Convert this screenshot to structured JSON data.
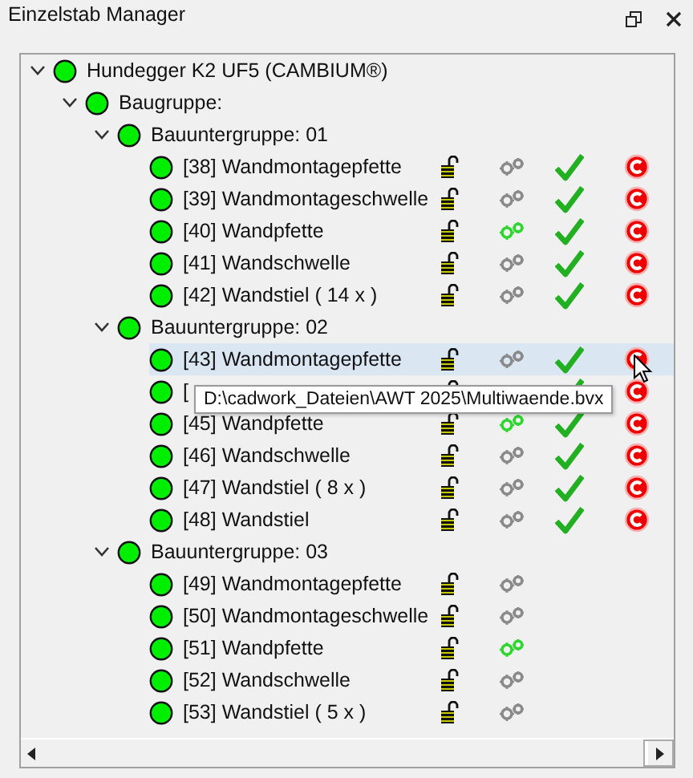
{
  "window": {
    "title": "Einzelstab Manager"
  },
  "tree": {
    "nodes": [
      {
        "label": "Hundegger K2 UF5 (CAMBIUM®)",
        "expanded": true,
        "children": [
          {
            "label": "Baugruppe:",
            "expanded": true,
            "children": [
              {
                "label": "Bauuntergruppe: 01",
                "expanded": true,
                "children": [
                  {
                    "label": "[38] Wandmontagepfette",
                    "selected": false,
                    "gears_active": false,
                    "checked": true,
                    "c_mark": true
                  },
                  {
                    "label": "[39] Wandmontageschwelle",
                    "selected": false,
                    "gears_active": false,
                    "checked": true,
                    "c_mark": true
                  },
                  {
                    "label": "[40] Wandpfette",
                    "selected": false,
                    "gears_active": true,
                    "checked": true,
                    "c_mark": true
                  },
                  {
                    "label": "[41] Wandschwelle",
                    "selected": false,
                    "gears_active": false,
                    "checked": true,
                    "c_mark": true
                  },
                  {
                    "label": "[42] Wandstiel ( 14 x )",
                    "selected": false,
                    "gears_active": false,
                    "checked": true,
                    "c_mark": true
                  }
                ]
              },
              {
                "label": "Bauuntergruppe: 02",
                "expanded": true,
                "children": [
                  {
                    "label": "[43] Wandmontagepfette",
                    "selected": true,
                    "gears_active": false,
                    "checked": true,
                    "c_mark": true
                  },
                  {
                    "label": "[",
                    "selected": false,
                    "checked": true,
                    "c_mark": true
                  },
                  {
                    "label": "[45] Wandpfette",
                    "selected": false,
                    "gears_active": true,
                    "checked": true,
                    "c_mark": true
                  },
                  {
                    "label": "[46] Wandschwelle",
                    "selected": false,
                    "gears_active": false,
                    "checked": true,
                    "c_mark": true
                  },
                  {
                    "label": "[47] Wandstiel ( 8 x )",
                    "selected": false,
                    "gears_active": false,
                    "checked": true,
                    "c_mark": true
                  },
                  {
                    "label": "[48] Wandstiel",
                    "selected": false,
                    "gears_active": false,
                    "checked": true,
                    "c_mark": true
                  }
                ]
              },
              {
                "label": "Bauuntergruppe: 03",
                "expanded": true,
                "children": [
                  {
                    "label": "[49] Wandmontagepfette",
                    "selected": false,
                    "gears_active": false,
                    "checked": false,
                    "c_mark": false
                  },
                  {
                    "label": "[50] Wandmontageschwelle",
                    "selected": false,
                    "gears_active": false,
                    "checked": false,
                    "c_mark": false
                  },
                  {
                    "label": "[51] Wandpfette",
                    "selected": false,
                    "gears_active": true,
                    "checked": false,
                    "c_mark": false
                  },
                  {
                    "label": "[52] Wandschwelle",
                    "selected": false,
                    "gears_active": false,
                    "checked": false,
                    "c_mark": false
                  },
                  {
                    "label": "[53] Wandstiel ( 5 x )",
                    "selected": false,
                    "gears_active": false,
                    "checked": false,
                    "c_mark": false
                  }
                ]
              }
            ]
          }
        ]
      }
    ]
  },
  "tooltip": {
    "text": "D:\\cadwork_Dateien\\AWT 2025\\Multiwaende.bvx"
  }
}
